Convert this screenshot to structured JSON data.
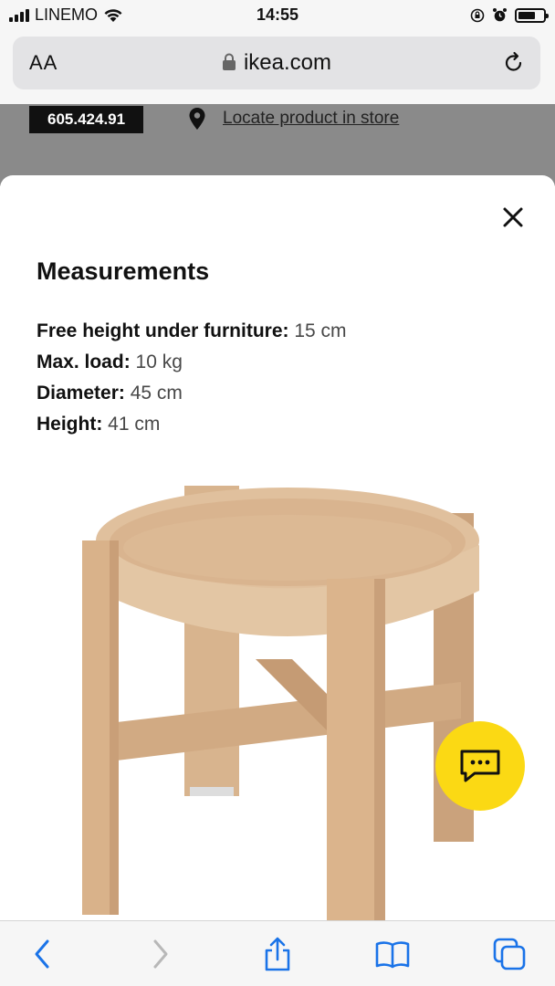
{
  "status_bar": {
    "carrier": "LINEMO",
    "time": "14:55"
  },
  "browser": {
    "text_size_label": "AA",
    "url": "ikea.com"
  },
  "product_strip": {
    "article_number": "605.424.91",
    "locate_link": "Locate product in store"
  },
  "measurements": {
    "title": "Measurements",
    "specs": [
      {
        "label": "Free height under furniture:",
        "value": " 15 cm"
      },
      {
        "label": "Max. load:",
        "value": " 10 kg"
      },
      {
        "label": "Diameter:",
        "value": " 45 cm"
      },
      {
        "label": "Height:",
        "value": " 41 cm"
      }
    ]
  },
  "colors": {
    "ikea_yellow": "#fbd914",
    "safari_blue": "#1a73e8",
    "wood": "#d9b48f"
  },
  "icons": {
    "close": "close-icon",
    "chat": "chat-icon",
    "back": "chevron-left-icon",
    "forward": "chevron-right-icon",
    "share": "share-icon",
    "bookmarks": "book-icon",
    "tabs": "tabs-icon"
  }
}
